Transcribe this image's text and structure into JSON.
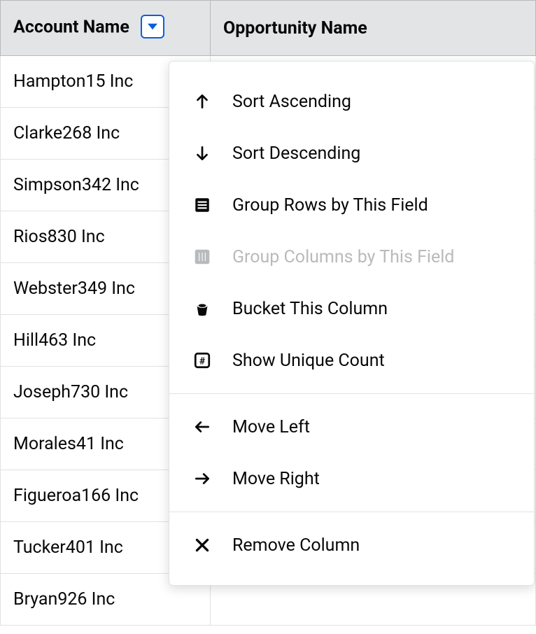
{
  "columns": {
    "account": "Account Name",
    "opportunity": "Opportunity Name"
  },
  "rows": [
    {
      "account": "Hampton15 Inc"
    },
    {
      "account": "Clarke268 Inc"
    },
    {
      "account": "Simpson342 Inc"
    },
    {
      "account": "Rios830 Inc"
    },
    {
      "account": "Webster349 Inc"
    },
    {
      "account": "Hill463 Inc"
    },
    {
      "account": "Joseph730 Inc"
    },
    {
      "account": "Morales41 Inc"
    },
    {
      "account": "Figueroa166 Inc"
    },
    {
      "account": "Tucker401 Inc"
    },
    {
      "account": "Bryan926 Inc"
    }
  ],
  "menu": {
    "sortAsc": "Sort Ascending",
    "sortDesc": "Sort Descending",
    "groupRows": "Group Rows by This Field",
    "groupCols": "Group Columns by This Field",
    "bucket": "Bucket This Column",
    "uniqueCount": "Show Unique Count",
    "moveLeft": "Move Left",
    "moveRight": "Move Right",
    "remove": "Remove Column"
  }
}
